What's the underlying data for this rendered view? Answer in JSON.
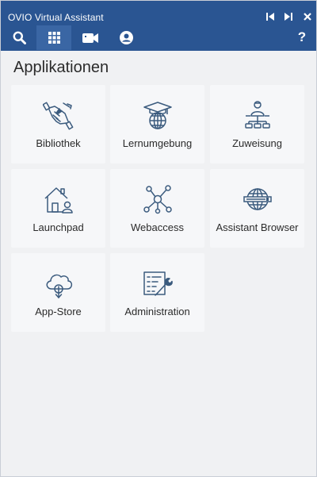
{
  "window": {
    "title": "OVIO Virtual Assistant"
  },
  "toolbar": {
    "help_label": "?"
  },
  "main": {
    "section_title": "Applikationen",
    "tiles": [
      {
        "label": "Bibliothek",
        "icon": "handshake-icon"
      },
      {
        "label": "Lernumgebung",
        "icon": "graduation-globe-icon"
      },
      {
        "label": "Zuweisung",
        "icon": "person-network-icon"
      },
      {
        "label": "Launchpad",
        "icon": "home-user-icon"
      },
      {
        "label": "Webaccess",
        "icon": "network-nodes-icon"
      },
      {
        "label": "Assistant Browser",
        "icon": "globe-browser-icon"
      },
      {
        "label": "App-Store",
        "icon": "cloud-download-icon"
      },
      {
        "label": "Administration",
        "icon": "settings-list-icon"
      }
    ]
  },
  "colors": {
    "header": "#2a5592",
    "active_tab": "#3a66a4",
    "icon_stroke": "#3b5b7e",
    "background": "#f0f1f3",
    "tile": "#f6f7f9"
  }
}
